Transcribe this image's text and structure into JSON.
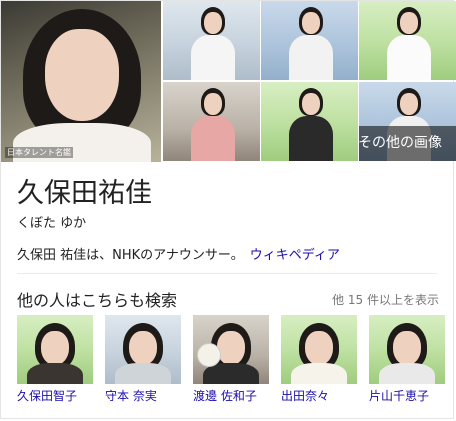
{
  "gallery": {
    "main_caption": "日本タレント名鑑",
    "more_images_label": "その他の画像"
  },
  "entity": {
    "title": "久保田祐佳",
    "reading": "くぼた ゆか",
    "description": "久保田 祐佳は、NHKのアナウンサー。",
    "source_link": "ウィキペディア"
  },
  "related": {
    "heading": "他の人はこちらも検索",
    "more_label": "他 15 件以上を表示",
    "people": [
      {
        "name": "久保田智子"
      },
      {
        "name": "守本 奈実"
      },
      {
        "name": "渡邊 佐和子"
      },
      {
        "name": "出田奈々"
      },
      {
        "name": "片山千恵子"
      }
    ]
  },
  "colors": {
    "link": "#1a0dab",
    "muted": "#777777"
  }
}
